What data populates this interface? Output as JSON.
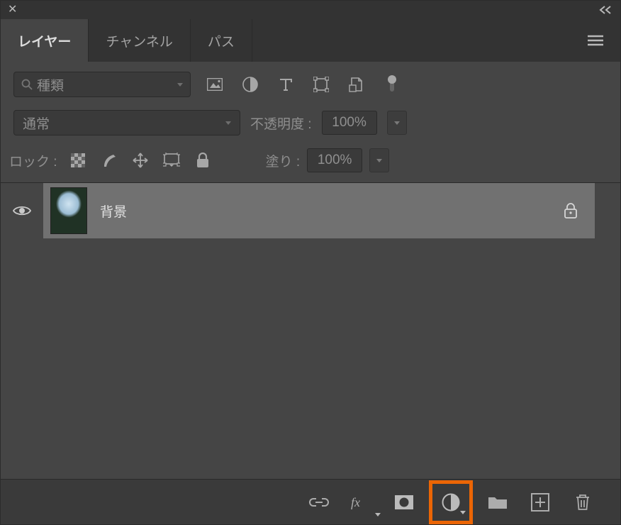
{
  "topbar": {},
  "tabs": {
    "items": [
      {
        "label": "レイヤー",
        "active": true
      },
      {
        "label": "チャンネル",
        "active": false
      },
      {
        "label": "パス",
        "active": false
      }
    ]
  },
  "filter": {
    "type_placeholder": "種類"
  },
  "blend": {
    "mode": "通常",
    "opacity_label": "不透明度 :",
    "opacity_value": "100%"
  },
  "lock": {
    "label": "ロック :",
    "fill_label": "塗り :",
    "fill_value": "100%"
  },
  "layers": [
    {
      "name": "背景",
      "locked": true,
      "visible": true
    }
  ],
  "footer": {
    "icons": [
      "link",
      "fx",
      "mask",
      "adjustment",
      "group",
      "new",
      "trash"
    ]
  }
}
